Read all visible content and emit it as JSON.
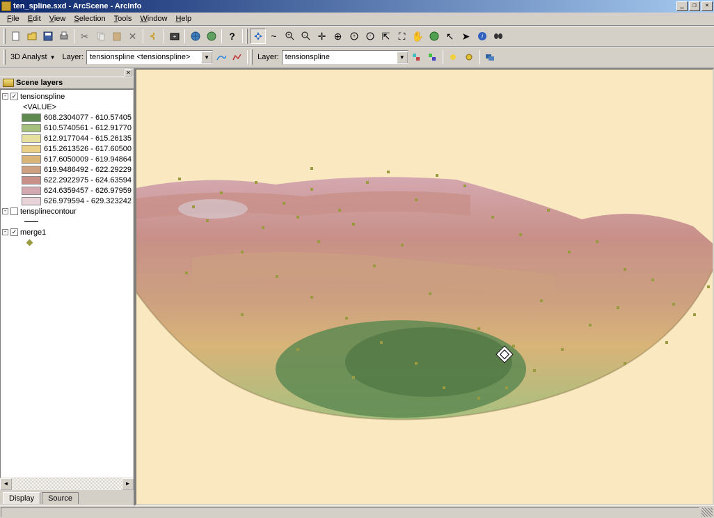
{
  "titlebar": {
    "title": "ten_spline.sxd - ArcScene - ArcInfo"
  },
  "menubar": {
    "items": [
      "File",
      "Edit",
      "View",
      "Selection",
      "Tools",
      "Window",
      "Help"
    ]
  },
  "toolbar2": {
    "analyst_label": "3D Analyst",
    "layer_label_1": "Layer:",
    "layer_select_1": "tensionspline <tensionspline>",
    "layer_label_2": "Layer:",
    "layer_select_2": "tensionspline"
  },
  "toc": {
    "title": "Scene layers",
    "layers": [
      {
        "name": "tensionspline",
        "checked": true,
        "expanded": true,
        "value_header": "<VALUE>",
        "classes": [
          {
            "label": "608.2304077 - 610.57405",
            "color": "#5e8a52"
          },
          {
            "label": "610.5740561 - 612.91770",
            "color": "#a6c080"
          },
          {
            "label": "612.9177044 - 615.26135",
            "color": "#e6e0a0"
          },
          {
            "label": "615.2613526 - 617.60500",
            "color": "#e8d088"
          },
          {
            "label": "617.6050009 - 619.94864",
            "color": "#d8b478"
          },
          {
            "label": "619.9486492 - 622.29229",
            "color": "#cca080"
          },
          {
            "label": "622.2922975 - 624.63594",
            "color": "#c89088"
          },
          {
            "label": "624.6359457 - 626.97959",
            "color": "#d4a8b0"
          },
          {
            "label": "626.979594 - 629.323242",
            "color": "#e8d4d8"
          }
        ]
      },
      {
        "name": "tensplinecontour",
        "checked": false,
        "expanded": true
      },
      {
        "name": "merge1",
        "checked": true,
        "expanded": true
      }
    ],
    "tabs": {
      "display": "Display",
      "source": "Source"
    }
  }
}
